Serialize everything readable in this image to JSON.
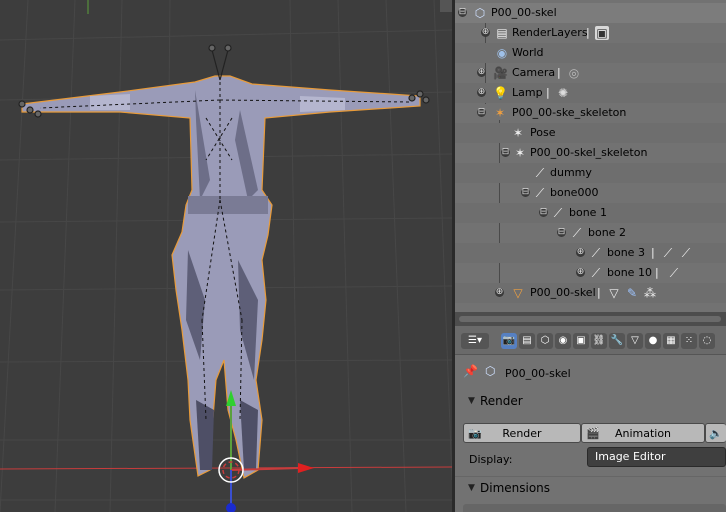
{
  "outliner": {
    "rows": [
      {
        "label": "P00_00-skel",
        "expander": "⊟",
        "icon": "⬡"
      },
      {
        "label": "RenderLayers",
        "expander": "⊕",
        "icon": "▤",
        "extra": "|"
      },
      {
        "label": "World",
        "icon": "◉"
      },
      {
        "label": "Camera",
        "expander": "⊕",
        "icon": "🎥",
        "extra": "|"
      },
      {
        "label": "Lamp",
        "expander": "⊕",
        "icon": "💡",
        "extra": "|"
      },
      {
        "label": "P00_00-ske_skeleton",
        "expander": "⊟",
        "icon": "✶"
      },
      {
        "label": "Pose",
        "icon": "✶"
      },
      {
        "label": "P00_00-skel_skeleton",
        "expander": "⊟",
        "icon": "✶"
      },
      {
        "label": "dummy",
        "icon": "⟋"
      },
      {
        "label": "bone000",
        "expander": "⊟",
        "icon": "⟋"
      },
      {
        "label": "bone 1",
        "expander": "⊟",
        "icon": "⟋"
      },
      {
        "label": "bone 2",
        "expander": "⊟",
        "icon": "⟋"
      },
      {
        "label": "bone 3",
        "expander": "⊕",
        "icon": "⟋",
        "extra": "|"
      },
      {
        "label": "bone 10",
        "expander": "⊕",
        "icon": "⟋",
        "extra": "|"
      },
      {
        "label": "P00_00-skel",
        "expander": "⊕",
        "icon": "▽",
        "extra": "|"
      }
    ]
  },
  "properties": {
    "breadcrumb": "P00_00-skel",
    "render_panel": {
      "title": "Render",
      "render_button": "Render",
      "animation_button": "Animation",
      "display_label": "Display:",
      "display_value": "Image Editor"
    },
    "dimensions_panel": {
      "title": "Dimensions"
    }
  },
  "colors": {
    "viewport_bg": "#3d3d3d",
    "grid": "#474747",
    "x_axis": "#c83c3c",
    "y_axis": "#5aa03c",
    "selection_outline": "#e89b3a"
  }
}
